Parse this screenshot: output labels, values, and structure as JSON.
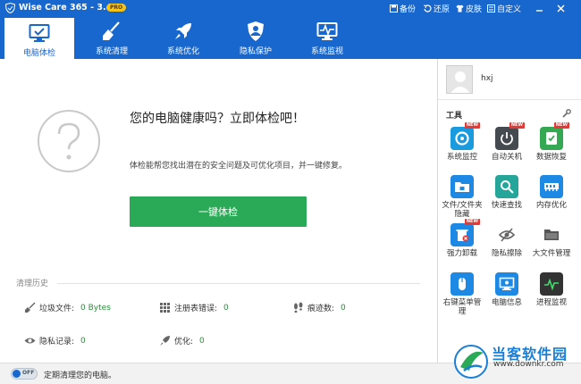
{
  "app": {
    "title": "Wise Care 365 - 3.4.6",
    "badge": "PRO"
  },
  "titlebar": {
    "backup": "备份",
    "restore": "还原",
    "skin": "皮肤",
    "customize": "自定义"
  },
  "nav": {
    "tabs": [
      {
        "label": "电脑体检",
        "icon": "monitor-check-icon",
        "active": true
      },
      {
        "label": "系统清理",
        "icon": "broom-icon",
        "active": false
      },
      {
        "label": "系统优化",
        "icon": "rocket-icon",
        "active": false
      },
      {
        "label": "隐私保护",
        "icon": "shield-user-icon",
        "active": false
      },
      {
        "label": "系统监视",
        "icon": "pulse-monitor-icon",
        "active": false
      }
    ]
  },
  "main": {
    "headline": "您的电脑健康吗？立即体检吧！",
    "description": "体检能帮您找出潜在的安全问题及可优化项目，并一键修复。",
    "scan_button": "一键体检",
    "history": {
      "title": "清理历史",
      "stats": [
        {
          "label": "垃圾文件:",
          "value": "0 Bytes",
          "icon": "broom-icon"
        },
        {
          "label": "注册表错误:",
          "value": "0",
          "icon": "grid-icon"
        },
        {
          "label": "痕迹数:",
          "value": "0",
          "icon": "footprint-icon"
        },
        {
          "label": "隐私记录:",
          "value": "0",
          "icon": "eye-icon"
        },
        {
          "label": "优化:",
          "value": "0",
          "icon": "rocket-icon"
        }
      ]
    }
  },
  "sidebar": {
    "username": "hxj",
    "tools_title": "工具",
    "new_badge": "NEW",
    "tools": [
      {
        "label": "系统监控",
        "icon": "monitor-ring-icon",
        "color": "#1a9be0",
        "new": true
      },
      {
        "label": "自动关机",
        "icon": "power-icon",
        "color": "#444a50",
        "new": true
      },
      {
        "label": "数据恢复",
        "icon": "data-recovery-icon",
        "color": "#34a853",
        "new": true
      },
      {
        "label": "文件/文件夹隐藏",
        "icon": "folder-lock-icon",
        "color": "#1e88e5",
        "new": false
      },
      {
        "label": "快速查找",
        "icon": "search-icon",
        "color": "#26a69a",
        "new": false
      },
      {
        "label": "内存优化",
        "icon": "memory-icon",
        "color": "#1e88e5",
        "new": false
      },
      {
        "label": "强力卸载",
        "icon": "uninstall-icon",
        "color": "#1e88e5",
        "new": true
      },
      {
        "label": "隐私擦除",
        "icon": "eraser-icon",
        "color": "#777777",
        "new": false
      },
      {
        "label": "大文件管理",
        "icon": "big-folder-icon",
        "color": "#555555",
        "new": false
      },
      {
        "label": "右键菜单管理",
        "icon": "mouse-icon",
        "color": "#1e88e5",
        "new": false
      },
      {
        "label": "电脑信息",
        "icon": "pc-info-icon",
        "color": "#1e88e5",
        "new": false
      },
      {
        "label": "进程监视",
        "icon": "process-icon",
        "color": "#333333",
        "new": false
      }
    ]
  },
  "footer": {
    "toggle": "OFF",
    "text": "定期清理您的电脑。"
  },
  "watermark": {
    "name": "当客软件园",
    "url": "www.downkr.com"
  },
  "colors": {
    "header": "#1767cf",
    "accent_green": "#2aaa57",
    "value_green": "#2a8c3a"
  }
}
